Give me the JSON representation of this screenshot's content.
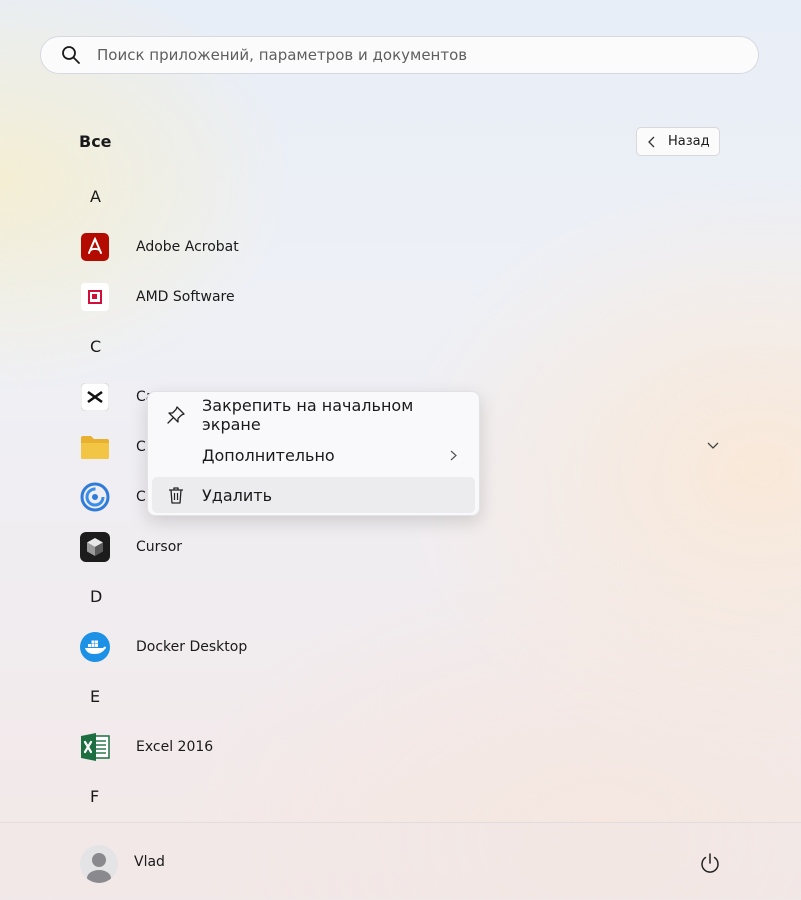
{
  "search": {
    "placeholder": "Поиск приложений, параметров и документов"
  },
  "header": {
    "title": "Все",
    "back_label": "Назад"
  },
  "letters": {
    "a": "A",
    "c": "C",
    "d": "D",
    "e": "E",
    "f": "F"
  },
  "apps": {
    "adobe": "Adobe Acrobat",
    "amd": "AMD Software",
    "capcut_partial": "Ca",
    "folder_partial": "Cl",
    "circle_partial": "Cl",
    "cursor": "Cursor",
    "docker": "Docker Desktop",
    "excel": "Excel 2016"
  },
  "context_menu": {
    "pin": "Закрепить на начальном экране",
    "more": "Дополнительно",
    "delete": "Удалить"
  },
  "footer": {
    "user": "Vlad"
  },
  "colors": {
    "acrobat": "#b30b00",
    "amd": "#d0103a",
    "docker": "#1d91e6",
    "excel": "#1d6f42",
    "folder": "#f3c544"
  },
  "icons": {
    "search": "search-icon",
    "back": "chevron-left-icon",
    "adobe": "adobe-acrobat-icon",
    "amd": "amd-icon",
    "capcut": "capcut-icon",
    "folder": "folder-icon",
    "circle": "spiral-icon",
    "cursor": "cursor-icon",
    "docker": "docker-icon",
    "excel": "excel-icon",
    "pin": "pin-icon",
    "more": "chevron-right-icon",
    "delete": "trash-icon",
    "avatar": "user-avatar-icon",
    "power": "power-icon"
  }
}
